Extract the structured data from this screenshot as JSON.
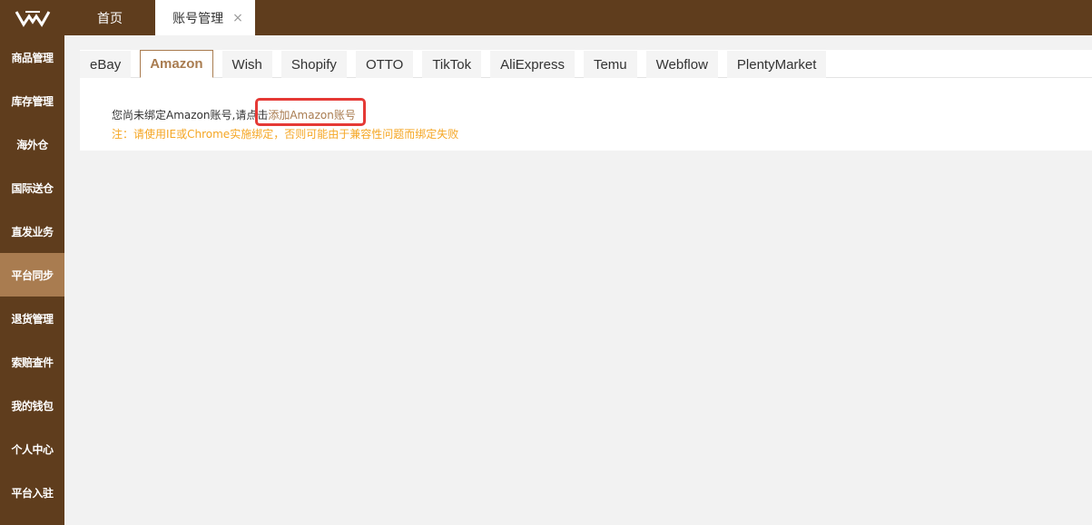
{
  "header": {
    "tabs": [
      {
        "label": "首页",
        "active": false
      },
      {
        "label": "账号管理",
        "active": true,
        "close": "×"
      }
    ]
  },
  "sidebar": {
    "items": [
      {
        "label": "商品管理",
        "active": false
      },
      {
        "label": "库存管理",
        "active": false
      },
      {
        "label": "海外仓",
        "active": false
      },
      {
        "label": "国际送仓",
        "active": false
      },
      {
        "label": "直发业务",
        "active": false
      },
      {
        "label": "平台同步",
        "active": true
      },
      {
        "label": "退货管理",
        "active": false
      },
      {
        "label": "索赔查件",
        "active": false
      },
      {
        "label": "我的钱包",
        "active": false
      },
      {
        "label": "个人中心",
        "active": false
      },
      {
        "label": "平台入驻",
        "active": false
      }
    ]
  },
  "platform_tabs": [
    {
      "label": "eBay",
      "active": false
    },
    {
      "label": "Amazon",
      "active": true
    },
    {
      "label": "Wish",
      "active": false
    },
    {
      "label": "Shopify",
      "active": false
    },
    {
      "label": "OTTO",
      "active": false
    },
    {
      "label": "TikTok",
      "active": false
    },
    {
      "label": "AliExpress",
      "active": false
    },
    {
      "label": "Temu",
      "active": false
    },
    {
      "label": "Webflow",
      "active": false
    },
    {
      "label": "PlentyMarket",
      "active": false
    }
  ],
  "content": {
    "message_prefix": "您尚未绑定Amazon账号,请点击",
    "add_link": "添加Amazon账号",
    "note": "注：请使用IE或Chrome实施绑定，否则可能由于兼容性问题而绑定失败"
  },
  "colors": {
    "brand_dark": "#5f3d1d",
    "brand_accent": "#a97c50",
    "note_orange": "#f5a623",
    "highlight_red": "#e53935"
  }
}
